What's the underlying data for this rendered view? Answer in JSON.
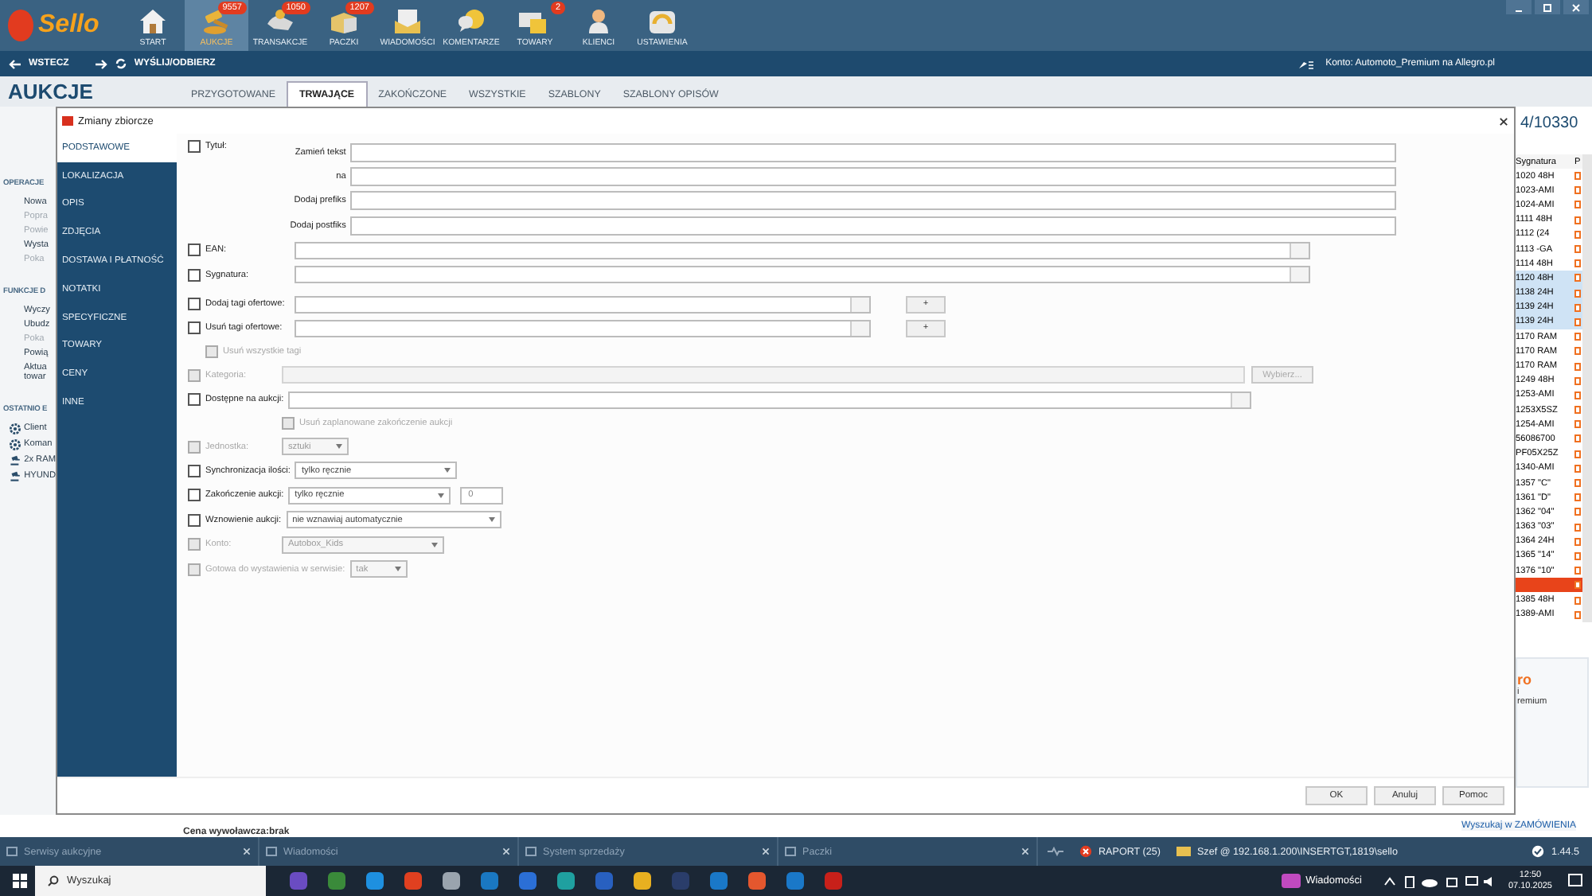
{
  "app": {
    "logo": "Sello"
  },
  "toolbar": [
    {
      "label": "START",
      "selected": false
    },
    {
      "label": "AUKCJE",
      "badge": "9557",
      "selected": true
    },
    {
      "label": "TRANSAKCJE",
      "badge": "1050",
      "selected": false
    },
    {
      "label": "PACZKI",
      "badge": "1207",
      "selected": false
    },
    {
      "label": "WIADOMOŚCI",
      "selected": false
    },
    {
      "label": "KOMENTARZE",
      "selected": false
    },
    {
      "label": "TOWARY",
      "badge": "2",
      "selected": false
    },
    {
      "label": "KLIENCI",
      "selected": false
    },
    {
      "label": "USTAWIENIA",
      "selected": false
    }
  ],
  "nav": {
    "back": "WSTECZ",
    "sync": "WYŚLIJ/ODBIERZ",
    "account": "Konto: Automoto_Premium na Allegro.pl"
  },
  "page": {
    "title": "AUKCJE",
    "tabs": [
      {
        "label": "PRZYGOTOWANE",
        "selected": false
      },
      {
        "label": "TRWAJĄCE",
        "selected": true
      },
      {
        "label": "ZAKOŃCZONE",
        "selected": false
      },
      {
        "label": "WSZYSTKIE",
        "selected": false
      },
      {
        "label": "SZABLONY",
        "selected": false
      },
      {
        "label": "SZABLONY OPISÓW",
        "selected": false
      }
    ],
    "left_panel": [
      {
        "title": "OPERACJE",
        "items": [
          {
            "label": "Nowa",
            "disabled": false
          },
          {
            "label": "Popra",
            "disabled": true
          },
          {
            "label": "Powie",
            "disabled": true
          },
          {
            "label": "Wysta",
            "disabled": false
          },
          {
            "label": "Poka",
            "disabled": true
          }
        ]
      },
      {
        "title": "FUNKCJE D",
        "items": [
          {
            "label": "Wyczy",
            "disabled": false
          },
          {
            "label": "Ubudz",
            "disabled": false
          },
          {
            "label": "Poka",
            "disabled": true
          },
          {
            "label": "Powią",
            "disabled": false
          },
          {
            "label": "Aktua\ntowar",
            "disabled": false
          }
        ]
      },
      {
        "title": "OSTATNIO E",
        "items": [
          {
            "label": "Client",
            "kind": "gear",
            "disabled": false
          },
          {
            "label": "Koman",
            "kind": "gear",
            "disabled": false
          },
          {
            "label": "2x RAM",
            "kind": "gavel",
            "disabled": false
          },
          {
            "label": "HYUND",
            "kind": "gavel",
            "disabled": false
          }
        ]
      }
    ],
    "counter": "4/10330",
    "table": {
      "column_1": "Sygnatura",
      "column_2": "P",
      "rows": [
        {
          "text": "1020 48H",
          "selected": false,
          "flagged": false
        },
        {
          "text": "1023-AMI",
          "selected": false,
          "flagged": false
        },
        {
          "text": "1024-AMI",
          "selected": false,
          "flagged": false
        },
        {
          "text": "1111 48H",
          "selected": false,
          "flagged": false
        },
        {
          "text": "1112 (24",
          "selected": false,
          "flagged": false
        },
        {
          "text": "1113 -GA",
          "selected": false,
          "flagged": false
        },
        {
          "text": "1114 48H",
          "selected": false,
          "flagged": false
        },
        {
          "text": "1120 48H",
          "selected": true,
          "flagged": false
        },
        {
          "text": "1138 24H",
          "selected": true,
          "flagged": false
        },
        {
          "text": "1139 24H",
          "selected": true,
          "flagged": false
        },
        {
          "text": "1139 24H",
          "selected": true,
          "flagged": false
        },
        {
          "text": "1170 RAM",
          "selected": false,
          "flagged": false
        },
        {
          "text": "1170 RAM",
          "selected": false,
          "flagged": false
        },
        {
          "text": "1170 RAM",
          "selected": false,
          "flagged": false
        },
        {
          "text": "1249 48H",
          "selected": false,
          "flagged": false
        },
        {
          "text": "1253-AMI",
          "selected": false,
          "flagged": false
        },
        {
          "text": "1253X5SZ",
          "selected": false,
          "flagged": false
        },
        {
          "text": "1254-AMI",
          "selected": false,
          "flagged": false
        },
        {
          "text": "56086700",
          "selected": false,
          "flagged": false
        },
        {
          "text": "PF05X25Z",
          "selected": false,
          "flagged": false
        },
        {
          "text": "1340-AMI",
          "selected": false,
          "flagged": false
        },
        {
          "text": "1357 \"C\"",
          "selected": false,
          "flagged": false
        },
        {
          "text": "1361 \"D\"",
          "selected": false,
          "flagged": false
        },
        {
          "text": "1362 \"04\"",
          "selected": false,
          "flagged": false
        },
        {
          "text": "1363 \"03\"",
          "selected": false,
          "flagged": false
        },
        {
          "text": "1364 24H",
          "selected": false,
          "flagged": false
        },
        {
          "text": "1365 \"14\"",
          "selected": false,
          "flagged": false
        },
        {
          "text": "1376 \"10\"",
          "selected": false,
          "flagged": false
        },
        {
          "selected": false,
          "flagged": true
        },
        {
          "text": "1385 48H",
          "selected": false,
          "flagged": false
        },
        {
          "text": "1389-AMI",
          "selected": false,
          "flagged": false
        }
      ]
    },
    "side_card": [
      "ro",
      "i",
      "remium"
    ],
    "footer_text": "Cena wywoławcza:brak",
    "link": "Wyszukaj w ZAMÓWIENIA"
  },
  "dialog": {
    "title": "Zmiany zbiorcze",
    "sidebar": [
      {
        "label": "PODSTAWOWE",
        "selected": true
      },
      {
        "label": "LOKALIZACJA",
        "selected": false
      },
      {
        "label": "OPIS",
        "selected": false
      },
      {
        "label": "ZDJĘCIA",
        "selected": false
      },
      {
        "label": "DOSTAWA I PŁATNOŚĆ",
        "selected": false
      },
      {
        "label": "NOTATKI",
        "selected": false
      },
      {
        "label": "SPECYFICZNE",
        "selected": false
      },
      {
        "label": "TOWARY",
        "selected": false
      },
      {
        "label": "CENY",
        "selected": false
      },
      {
        "label": "INNE",
        "selected": false
      }
    ],
    "rows": [
      {
        "kind": "title",
        "label": "Tytuł:",
        "checked": false,
        "disabled": false,
        "subfields": [
          "Zamień tekst",
          "na",
          "Dodaj prefiks",
          "Dodaj postfiks"
        ]
      },
      {
        "kind": "text",
        "label": "EAN:",
        "checked": false,
        "disabled": false
      },
      {
        "kind": "text",
        "label": "Sygnatura:",
        "checked": false,
        "disabled": false
      },
      {
        "kind": "tags",
        "label": "Dodaj tagi ofertowe:",
        "checked": false,
        "disabled": false,
        "button": "+"
      },
      {
        "kind": "tags",
        "label": "Usuń tagi ofertowe:",
        "checked": false,
        "disabled": false,
        "button": "+",
        "children": [
          {
            "label": "Usuń wszystkie tagi",
            "checked": false,
            "disabled": true
          }
        ]
      },
      {
        "kind": "picker",
        "label": "Kategoria:",
        "checked": false,
        "disabled": true,
        "button": "Wybierz..."
      },
      {
        "kind": "combo",
        "label": "Dostępne na aukcji:",
        "checked": false,
        "disabled": false,
        "children": [
          {
            "label": "Usuń zaplanowane zakończenie aukcji",
            "checked": false,
            "disabled": true
          }
        ]
      },
      {
        "kind": "select",
        "label": "Jednostka:",
        "checked": false,
        "disabled": true,
        "value": "sztuki"
      },
      {
        "kind": "select",
        "label": "Synchronizacja ilości:",
        "checked": false,
        "disabled": false,
        "value": "tylko ręcznie"
      },
      {
        "kind": "select_number",
        "label": "Zakończenie aukcji:",
        "checked": false,
        "disabled": false,
        "value": "tylko ręcznie",
        "number": "0"
      },
      {
        "kind": "select",
        "label": "Wznowienie aukcji:",
        "checked": false,
        "disabled": false,
        "value": "nie wznawiaj automatycznie"
      },
      {
        "kind": "select",
        "label": "Konto:",
        "checked": false,
        "disabled": true,
        "value": "Autobox_Kids"
      },
      {
        "kind": "select",
        "label": "Gotowa do wystawienia w serwisie:",
        "checked": false,
        "disabled": true,
        "value": "tak"
      }
    ],
    "buttons": [
      "OK",
      "Anuluj",
      "Pomoc"
    ]
  },
  "status_bar": {
    "tabs": [
      "Serwisy aukcyjne",
      "Wiadomości",
      "System sprzedaży",
      "Paczki"
    ],
    "report": "RAPORT (25)",
    "connection": "Szef @ 192.168.1.200\\INSERTGT,1819\\sello",
    "version": "1.44.5"
  },
  "taskbar": {
    "search": "Wyszukaj",
    "news": "Wiadomości",
    "time": "12:50",
    "date": "07.10.2025"
  }
}
